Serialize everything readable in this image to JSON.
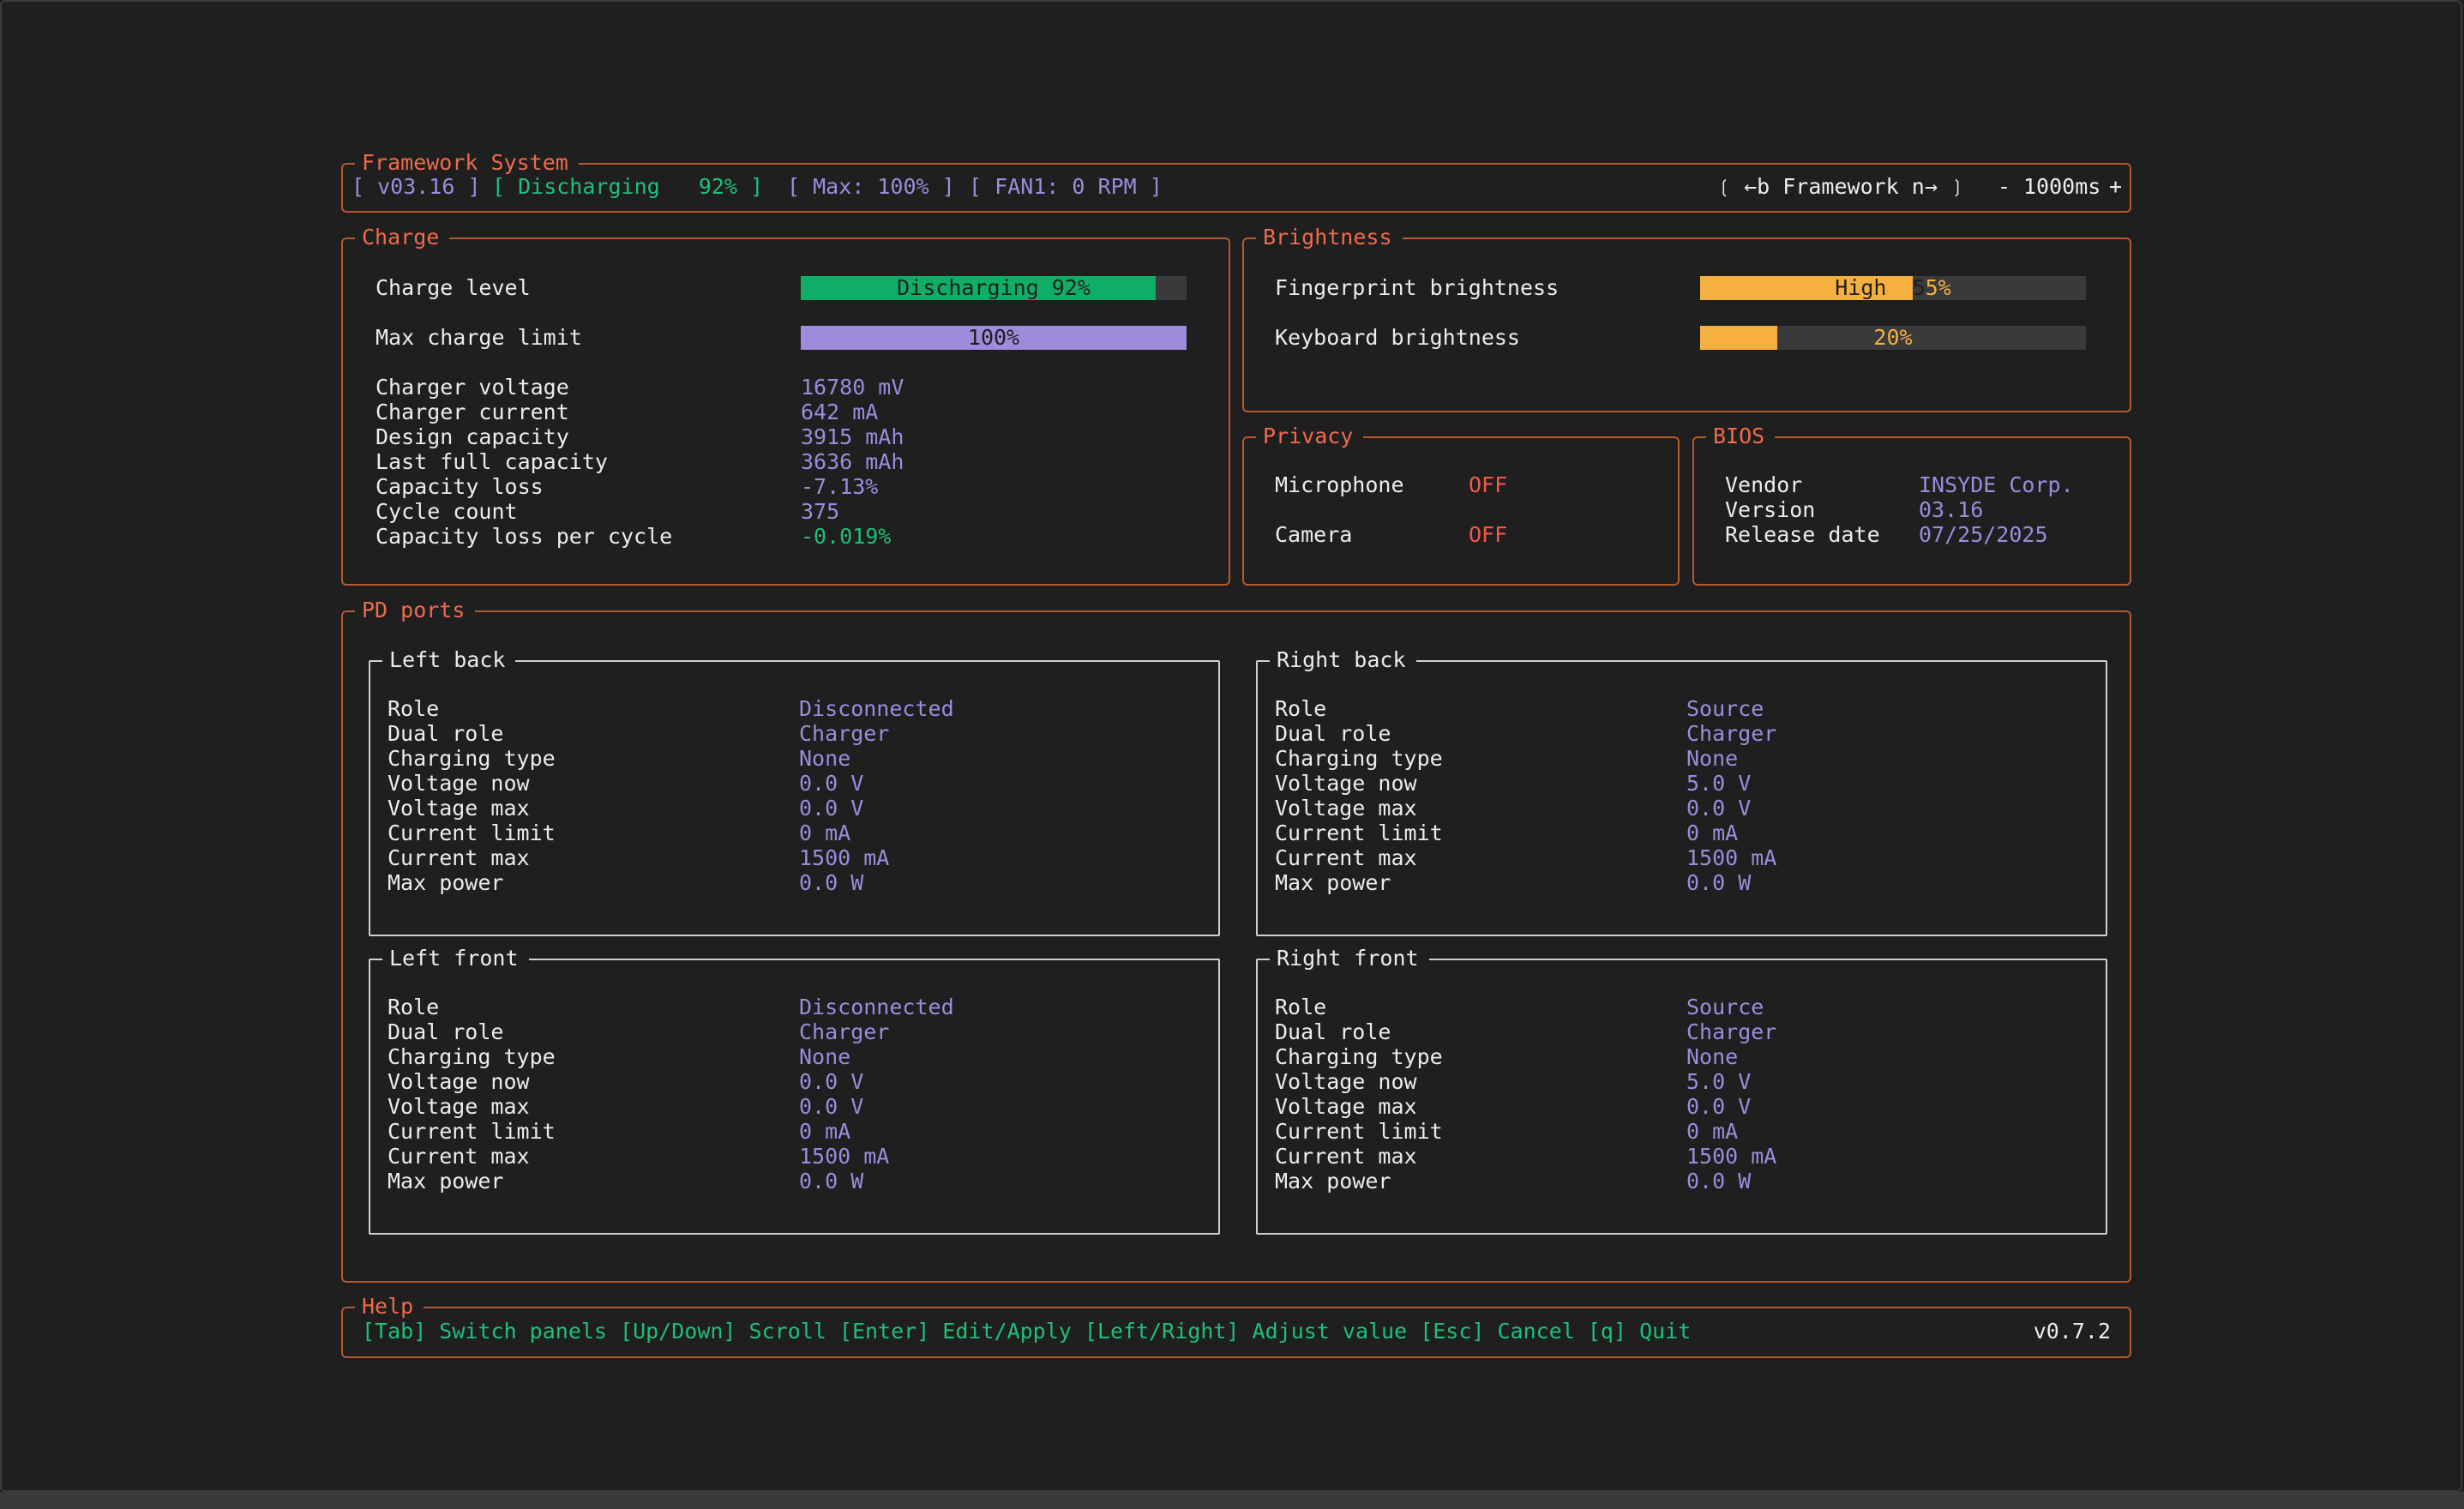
{
  "header": {
    "title": "Framework System",
    "version": "[ v03.16 ]",
    "status": "[ Discharging   92% ]",
    "max": "[ Max: 100% ]",
    "fan": "[ FAN1: 0 RPM ]",
    "device_selector": "❲ ←b Framework n→ ❳",
    "interval_minus": "-",
    "interval": "1000ms",
    "interval_plus": "+"
  },
  "charge": {
    "title": "Charge",
    "level_label": "Charge level",
    "level_bar_text": "Discharging 92%",
    "level_percent": 92,
    "max_label": "Max charge limit",
    "max_bar_text": "100%",
    "max_percent": 100,
    "stats": [
      {
        "label": "Charger voltage",
        "value": "16780 mV"
      },
      {
        "label": "Charger current",
        "value": "642 mA"
      },
      {
        "label": "Design capacity",
        "value": "3915 mAh"
      },
      {
        "label": "Last full capacity",
        "value": "3636 mAh"
      },
      {
        "label": "Capacity loss",
        "value": "-7.13%"
      },
      {
        "label": "Cycle count",
        "value": "375"
      },
      {
        "label": "Capacity loss per cycle",
        "value": "-0.019%"
      }
    ]
  },
  "brightness": {
    "title": "Brightness",
    "fingerprint_label": "Fingerprint brightness",
    "fingerprint_text_a": "High  5",
    "fingerprint_text_b": "5%",
    "fingerprint_percent": 55,
    "keyboard_label": "Keyboard brightness",
    "keyboard_text": "20%",
    "keyboard_percent": 20
  },
  "privacy": {
    "title": "Privacy",
    "microphone_label": "Microphone",
    "microphone_value": "OFF",
    "camera_label": "Camera",
    "camera_value": "OFF"
  },
  "bios": {
    "title": "BIOS",
    "vendor_label": "Vendor",
    "vendor_value": "INSYDE Corp.",
    "version_label": "Version",
    "version_value": "03.16",
    "date_label": "Release date",
    "date_value": "07/25/2025"
  },
  "pd_ports": {
    "title": "PD ports",
    "ports": [
      {
        "name": "Left back",
        "rows": [
          {
            "label": "Role",
            "value": "Disconnected"
          },
          {
            "label": "Dual role",
            "value": "Charger"
          },
          {
            "label": "Charging type",
            "value": "None"
          },
          {
            "label": "Voltage now",
            "value": "0.0 V"
          },
          {
            "label": "Voltage max",
            "value": "0.0 V"
          },
          {
            "label": "Current limit",
            "value": "0 mA"
          },
          {
            "label": "Current max",
            "value": "1500 mA"
          },
          {
            "label": "Max power",
            "value": "0.0 W"
          }
        ]
      },
      {
        "name": "Right back",
        "rows": [
          {
            "label": "Role",
            "value": "Source"
          },
          {
            "label": "Dual role",
            "value": "Charger"
          },
          {
            "label": "Charging type",
            "value": "None"
          },
          {
            "label": "Voltage now",
            "value": "5.0 V"
          },
          {
            "label": "Voltage max",
            "value": "0.0 V"
          },
          {
            "label": "Current limit",
            "value": "0 mA"
          },
          {
            "label": "Current max",
            "value": "1500 mA"
          },
          {
            "label": "Max power",
            "value": "0.0 W"
          }
        ]
      },
      {
        "name": "Left front",
        "rows": [
          {
            "label": "Role",
            "value": "Disconnected"
          },
          {
            "label": "Dual role",
            "value": "Charger"
          },
          {
            "label": "Charging type",
            "value": "None"
          },
          {
            "label": "Voltage now",
            "value": "0.0 V"
          },
          {
            "label": "Voltage max",
            "value": "0.0 V"
          },
          {
            "label": "Current limit",
            "value": "0 mA"
          },
          {
            "label": "Current max",
            "value": "1500 mA"
          },
          {
            "label": "Max power",
            "value": "0.0 W"
          }
        ]
      },
      {
        "name": "Right front",
        "rows": [
          {
            "label": "Role",
            "value": "Source"
          },
          {
            "label": "Dual role",
            "value": "Charger"
          },
          {
            "label": "Charging type",
            "value": "None"
          },
          {
            "label": "Voltage now",
            "value": "5.0 V"
          },
          {
            "label": "Voltage max",
            "value": "0.0 V"
          },
          {
            "label": "Current limit",
            "value": "0 mA"
          },
          {
            "label": "Current max",
            "value": "1500 mA"
          },
          {
            "label": "Max power",
            "value": "0.0 W"
          }
        ]
      }
    ]
  },
  "help": {
    "title": "Help",
    "text": "[Tab] Switch panels [Up/Down] Scroll [Enter] Edit/Apply [Left/Right] Adjust value [Esc] Cancel [q] Quit",
    "app_version": "v0.7.2"
  },
  "colors": {
    "background": "#1f1f1f",
    "border": "#b35a2e",
    "title": "#ef6b4a",
    "value": "#9d8bdc",
    "green": "#1fbf7a",
    "red": "#f0584a",
    "orange": "#f6b03f"
  }
}
